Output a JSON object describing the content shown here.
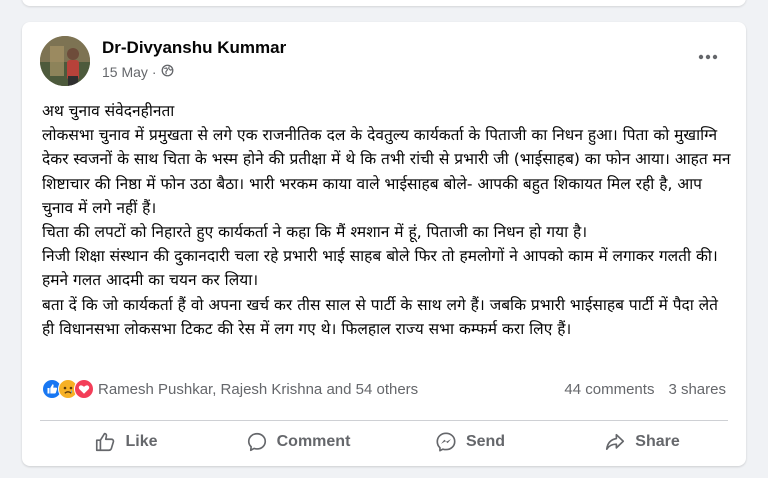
{
  "post": {
    "author": "Dr-Divyanshu Kummar",
    "date": "15 May",
    "dot": "·",
    "privacy_icon": "globe-icon",
    "more_icon": "more-options-icon",
    "text": "अथ चुनाव संवेदनहीनता\nलोकसभा चुनाव में प्रमुखता से लगे एक राजनीतिक दल के देवतुल्य कार्यकर्ता के पिताजी का निधन हुआ। पिता को मुखाग्नि देकर स्वजनों के साथ चिता के भस्म होने की प्रतीक्षा में थे कि तभी रांची से प्रभारी जी (भाईसाहब) का फोन आया। आहत मन शिष्टाचार की निष्ठा में फोन उठा बैठा। भारी भरकम काया वाले भाईसाहब बोले- आपकी बहुत शिकायत मिल रही है, आप चुनाव में लगे नहीं हैं।\nचिता की लपटों को निहारते हुए कार्यकर्ता ने कहा कि मैं श्मशान में हूं, पिताजी का निधन हो गया है।\nनिजी शिक्षा संस्थान की दुकानदारी चला रहे प्रभारी भाई साहब बोले फिर तो हमलोगों ने आपको काम में लगाकर गलती की। हमने गलत आदमी का चयन कर लिया।\nबता दें कि जो कार्यकर्ता हैं वो अपना खर्च कर तीस साल से पार्टी के साथ लगे हैं। जबकि प्रभारी भाईसाहब पार्टी में पैदा लेते ही विधानसभा लोकसभा टिकट की रेस में लग गए थे। फिलहाल राज्य सभा कम्फर्म करा लिए हैं।"
  },
  "reactions": {
    "icons": [
      "like-reaction-icon",
      "sad-reaction-icon",
      "love-reaction-icon"
    ],
    "names": "Ramesh Pushkar, Rajesh Krishna and 54 others",
    "comments": "44 comments",
    "shares": "3 shares"
  },
  "actions": {
    "like": "Like",
    "comment": "Comment",
    "send": "Send",
    "share": "Share"
  },
  "colors": {
    "like_blue": "#1877f2",
    "love_red": "#f33e58",
    "sad_yellow": "#f7b125",
    "secondary_text": "#65676b"
  }
}
